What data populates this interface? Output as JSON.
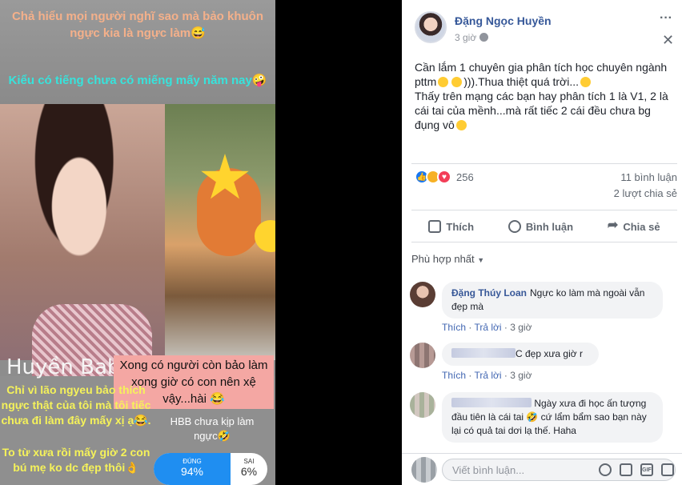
{
  "media": {
    "caption_top": "Chả hiểu mọi người nghĩ sao mà bảo khuôn ngực kia là ngực làm😅",
    "caption_mid": "Kiểu có tiếng chưa có miếng mấy năm nay🤪",
    "name_tag": "Huyền Baby -",
    "pink_caption": "Xong có người còn bảo làm xong giờ có con nên xệ vậy...hài 😂",
    "yellow_caption_1": "Chỉ vì lão ngyeu bảo thích ngực thật của tôi mà tôi tiếc chưa đi làm đây mấy xị ạ😂.",
    "white_caption": "HBB chưa kịp làm ngực🤣",
    "yellow_caption_2": "To từ xưa rồi mấy giờ 2 con bú mẹ ko dc đẹp thôi👌",
    "poll": {
      "left_label": "ĐÚNG",
      "left_value": "94%",
      "right_label": "SAI",
      "right_value": "6%"
    }
  },
  "post": {
    "author": "Đặng Ngọc Huyền",
    "time": "3 giờ",
    "more": "···",
    "close": "✕",
    "text_1": "Cần lắm 1 chuyên gia phân tích học chuyên ngành pttm",
    "text_1b": "))).Thua thiệt quá trời...",
    "text_2": "Thấy trên mạng các bạn hay phân tích 1 là V1, 2 là cái tai của mềnh...mà rất tiếc 2 cái đều chưa bg đụng vô",
    "reaction_count": "256",
    "comments_count": "11 bình luận",
    "shares_count": "2 lượt chia sẻ",
    "actions": {
      "like": "Thích",
      "comment": "Bình luận",
      "share": "Chia sẻ"
    },
    "sort_label": "Phù hợp nhất"
  },
  "comments": [
    {
      "name": "Đặng Thúy Loan",
      "text": "Ngực ko làm mà ngoài vẫn đẹp mà",
      "like": "Thích",
      "reply": "Trả lời",
      "time": "3 giờ"
    },
    {
      "name": "",
      "text": "C đẹp xưa giờ r",
      "like": "Thích",
      "reply": "Trả lời",
      "time": "3 giờ"
    },
    {
      "name": "",
      "text": "Ngày xưa đi học ấn tượng đầu tiên là cái tai 🤣 cứ lẩm bẩm sao bạn này lại có quả tai dơi lạ thế. Haha"
    }
  ],
  "compose": {
    "placeholder": "Viết bình luận..."
  },
  "colors": {
    "link": "#365899",
    "like_blue": "#1877f2",
    "panel_bg": "#ffffff"
  }
}
